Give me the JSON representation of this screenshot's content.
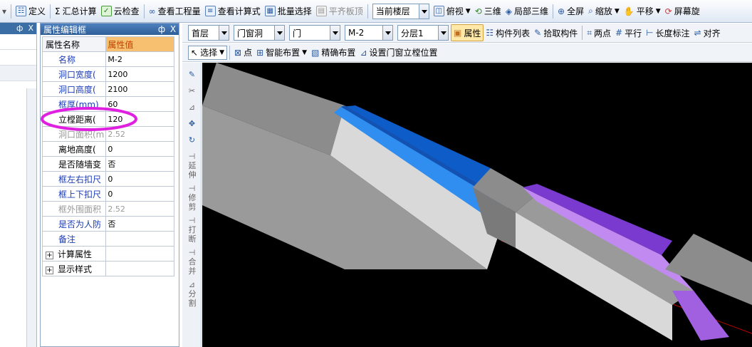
{
  "toolbar": {
    "define": "定义",
    "summary_calc": "汇总计算",
    "cloud_check": "云检查",
    "view_quantity": "查看工程量",
    "view_formula": "查看计算式",
    "batch_select": "批量选择",
    "align_slab": "平齐板顶",
    "floor_combo": "当前楼层",
    "top_view": "俯视",
    "three_d": "三维",
    "partial_3d": "局部三维",
    "fullscreen": "全屏",
    "zoom": "缩放",
    "pan": "平移",
    "screen_rotate": "屏幕旋"
  },
  "left_panel": {
    "pin": "ф",
    "close": "X"
  },
  "property_panel": {
    "title": "属性编辑框",
    "pin": "ф",
    "close": "X",
    "header_name": "属性名称",
    "header_value": "属性值",
    "rows": [
      {
        "name": "名称",
        "value": "M-2",
        "style": "blue"
      },
      {
        "name": "洞口宽度(",
        "value": "1200",
        "style": "blue"
      },
      {
        "name": "洞口高度(",
        "value": "2100",
        "style": "blue"
      },
      {
        "name": "框厚(mm)",
        "value": "60",
        "style": "blue"
      },
      {
        "name": "立樘距离(",
        "value": "120",
        "style": "normal"
      },
      {
        "name": "洞口面积(m",
        "value": "2.52",
        "style": "gray"
      },
      {
        "name": "离地高度(",
        "value": "0",
        "style": "normal"
      },
      {
        "name": "是否随墙变",
        "value": "否",
        "style": "normal"
      },
      {
        "name": "框左右扣尺",
        "value": "0",
        "style": "blue"
      },
      {
        "name": "框上下扣尺",
        "value": "0",
        "style": "blue"
      },
      {
        "name": "框外围面积",
        "value": "2.52",
        "style": "gray"
      },
      {
        "name": "是否为人防",
        "value": "否",
        "style": "blue"
      },
      {
        "name": "备注",
        "value": "",
        "style": "blue"
      },
      {
        "name": "计算属性",
        "value": "",
        "style": "group"
      },
      {
        "name": "显示样式",
        "value": "",
        "style": "group"
      }
    ]
  },
  "row2": {
    "floor": "首层",
    "category": "门窗洞",
    "type": "门",
    "element": "M-2",
    "layer": "分层1",
    "property": "属性",
    "component_list": "构件列表",
    "pick": "拾取构件",
    "two_point": "两点",
    "parallel": "平行",
    "length_dim": "长度标注",
    "align": "对齐"
  },
  "row3": {
    "select": "选择",
    "point": "点",
    "smart_layout": "智能布置",
    "precise_layout": "精确布置",
    "set_position": "设置门窗立樘位置"
  },
  "vertical_tools": {
    "extend": "延伸",
    "trim": "修剪",
    "break": "打断",
    "merge": "合并",
    "split": "分割"
  },
  "colors": {
    "highlight_ellipse": "#e020e0",
    "door_blue": "#1560c8",
    "door_purple": "#a060e0",
    "wall": "#bdbdbd"
  }
}
